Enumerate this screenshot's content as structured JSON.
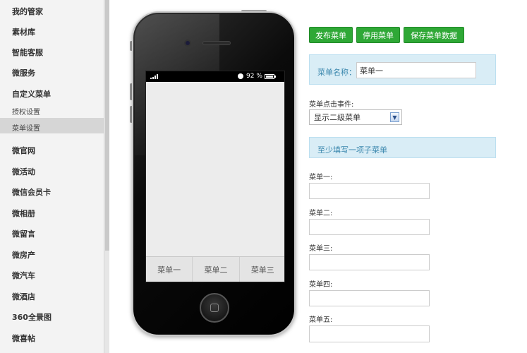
{
  "sidebar": {
    "items": [
      {
        "label": "我的管家",
        "type": "item"
      },
      {
        "label": "素材库",
        "type": "item"
      },
      {
        "label": "智能客服",
        "type": "item"
      },
      {
        "label": "微服务",
        "type": "item"
      },
      {
        "label": "自定义菜单",
        "type": "item"
      },
      {
        "label": "授权设置",
        "type": "sub"
      },
      {
        "label": "菜单设置",
        "type": "sub",
        "active": true
      },
      {
        "label": "微官网",
        "type": "item"
      },
      {
        "label": "微活动",
        "type": "item"
      },
      {
        "label": "微信会员卡",
        "type": "item"
      },
      {
        "label": "微相册",
        "type": "item"
      },
      {
        "label": "微留言",
        "type": "item"
      },
      {
        "label": "微房产",
        "type": "item"
      },
      {
        "label": "微汽车",
        "type": "item"
      },
      {
        "label": "微酒店",
        "type": "item"
      },
      {
        "label": "360全景图",
        "type": "item"
      },
      {
        "label": "微喜帖",
        "type": "item"
      }
    ]
  },
  "phone": {
    "status": {
      "battery": "92 %"
    },
    "menu_tabs": [
      "菜单一",
      "菜单二",
      "菜单三"
    ]
  },
  "toolbar": {
    "publish": "发布菜单",
    "disable": "停用菜单",
    "save": "保存菜单数据"
  },
  "form": {
    "name_label": "菜单名称：",
    "name_value": "菜单一",
    "event_label": "菜单点击事件:",
    "event_selected": "显示二级菜单",
    "notice": "至少填写一项子菜单",
    "submenu_labels": [
      "菜单一:",
      "菜单二:",
      "菜单三:",
      "菜单四:",
      "菜单五:"
    ]
  },
  "colors": {
    "button_green": "#2fa836",
    "info_bg": "#d9edf6",
    "info_text": "#3a87ad"
  }
}
